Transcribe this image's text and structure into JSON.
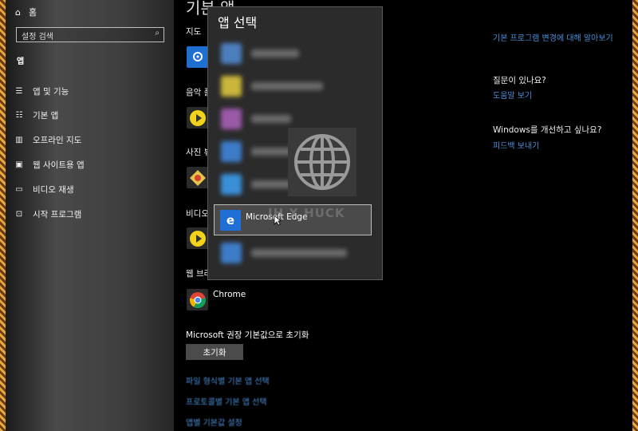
{
  "sidebar": {
    "home_label": "홈",
    "search_placeholder": "설정 검색",
    "section_title": "앱",
    "items": [
      {
        "label": "앱 및 기능",
        "icon": "list-icon"
      },
      {
        "label": "기본 앱",
        "icon": "list-check-icon"
      },
      {
        "label": "오프라인 지도",
        "icon": "map-icon"
      },
      {
        "label": "웹 사이트용 앱",
        "icon": "web-app-icon"
      },
      {
        "label": "비디오 재생",
        "icon": "video-icon"
      },
      {
        "label": "시작 프로그램",
        "icon": "startup-icon"
      }
    ]
  },
  "main": {
    "title": "기본 앱",
    "categories": [
      "지도",
      "음악 플",
      "사진 뷰",
      "비디오",
      "웹 브라"
    ],
    "chrome_label": "Chrome",
    "reset_label": "Microsoft 권장 기본값으로 초기화",
    "reset_button": "초기화",
    "links": [
      "파일 형식별 기본 앱 선택",
      "프로토콜별 기본 앱 선택",
      "앱별 기본값 설정"
    ]
  },
  "right_panel": {
    "link_top": "기본 프로그램 변경에 대해 알아보기",
    "question_heading": "질문이 있나요?",
    "help_link": "도움말 보기",
    "improve_heading": "Windows를 개선하고 싶나요?",
    "feedback_link": "피드백 보내기"
  },
  "popup": {
    "title": "앱 선택",
    "selected_app": "Microsoft Edge",
    "watermark": "JH X HUCK"
  },
  "colors": {
    "link_blue": "#4c8fd8",
    "edge_blue": "#1f6fd6",
    "popup_bg": "#2b2b2b"
  }
}
